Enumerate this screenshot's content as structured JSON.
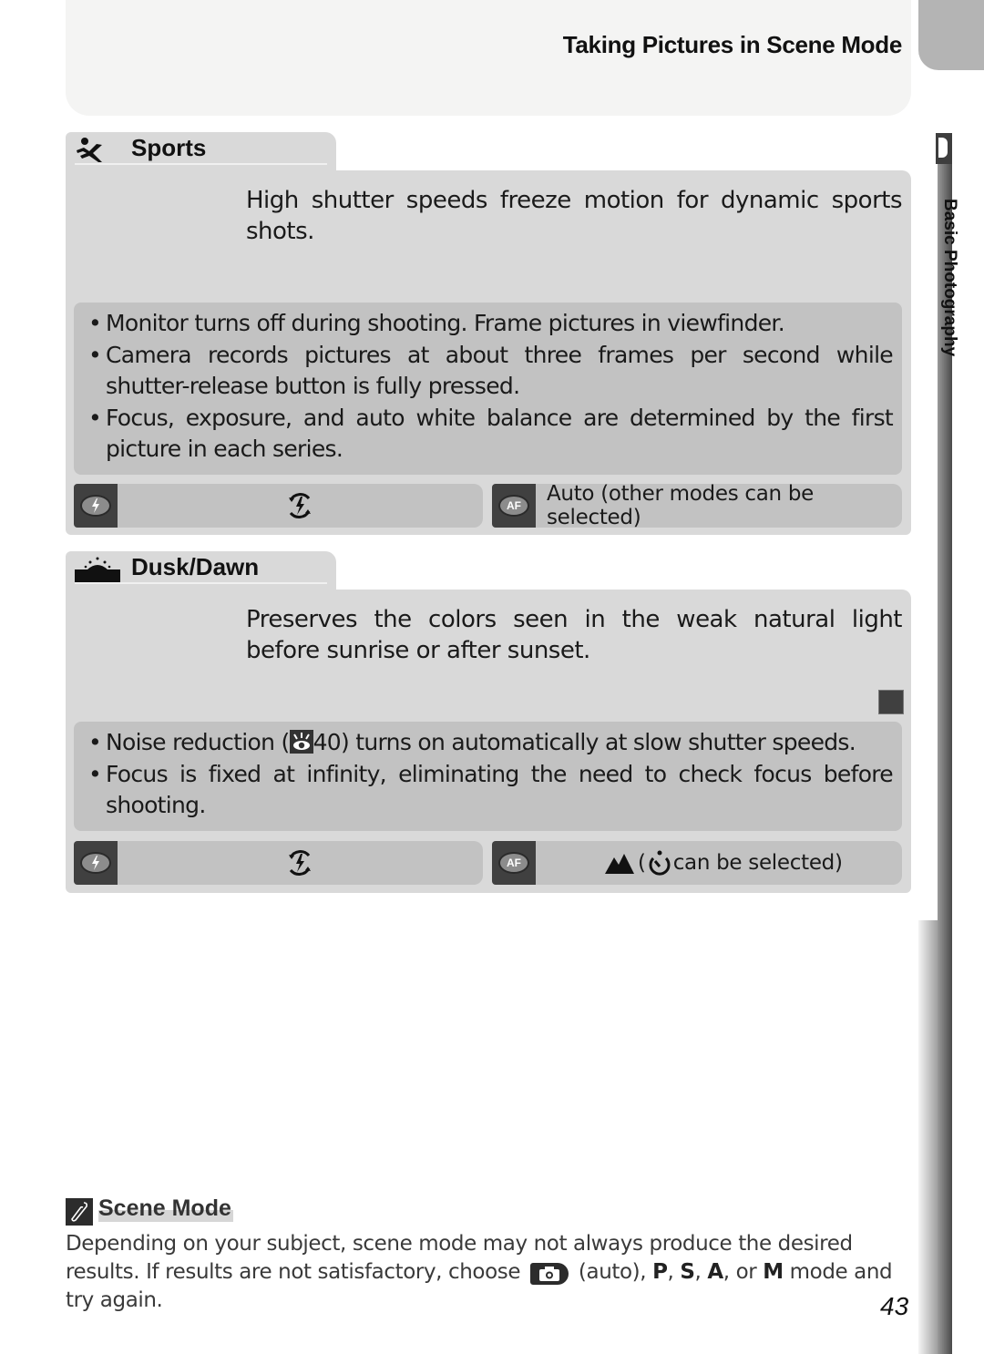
{
  "header": {
    "title": "Taking Pictures in Scene Mode"
  },
  "side_tab": {
    "label": "Basic Photography"
  },
  "sections": [
    {
      "icon": "sports-runner-icon",
      "title": "Sports",
      "description": "High shutter speeds freeze motion for dynamic sports shots.",
      "notes": [
        "Monitor turns off during shooting.  Frame pictures in viewfinder.",
        "Camera records pictures at about three frames per second while shutter-release button is fully pressed.",
        "Focus, exposure, and auto white balance are determined by the first picture in each series."
      ],
      "flash_setting": {
        "key_icon": "flash-mode-icon",
        "value_icon": "flash-off-icon"
      },
      "focus_setting": {
        "key_label": "AF",
        "value": "Auto (other modes can be selected)"
      }
    },
    {
      "icon": "dusk-dawn-icon",
      "title": "Dusk/Dawn",
      "description": "Preserves the colors seen in the weak natural light before sunrise or after sunset.",
      "notes_parts": {
        "note1_before": "Noise reduction (",
        "note1_ref": "40",
        "note1_after": ") turns on automatically at slow shutter speeds."
      },
      "notes": [
        "Focus is fixed at infinity, eliminating the need to check focus before shooting."
      ],
      "flash_setting": {
        "key_icon": "flash-mode-icon",
        "value_icon": "flash-off-icon"
      },
      "focus_setting": {
        "key_label": "AF",
        "value_open": "(",
        "value": " can be selected)"
      }
    }
  ],
  "tip": {
    "title": "Scene Mode",
    "text_1": "Depending on your subject, scene mode may not always produce the desired results.  If results are not satisfactory, choose ",
    "text_2": " (auto), ",
    "mode_p": "P",
    "sep1": ", ",
    "mode_s": "S",
    "sep2": ", ",
    "mode_a": "A",
    "sep3": ", or ",
    "mode_m": "M",
    "text_3": " mode and try again."
  },
  "page_number": "43"
}
